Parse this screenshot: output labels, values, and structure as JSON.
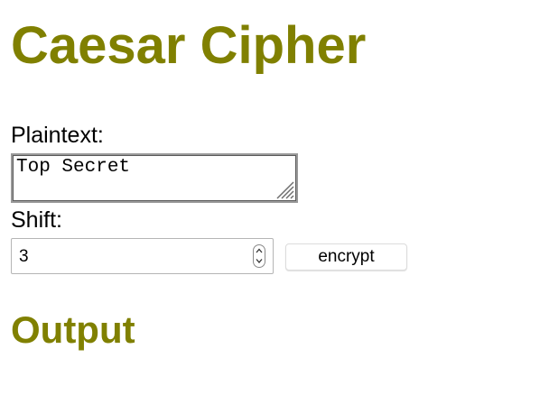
{
  "page": {
    "title": "Caesar Cipher",
    "accent_color": "#808000"
  },
  "form": {
    "plaintext_label": "Plaintext:",
    "plaintext_value": "Top Secret",
    "shift_label": "Shift:",
    "shift_value": "3",
    "encrypt_label": "encrypt"
  },
  "output": {
    "heading": "Output",
    "text": ""
  },
  "icons": {
    "resize_grip": "resize-grip-icon",
    "stepper_up": "chevron-up-icon",
    "stepper_down": "chevron-down-icon"
  }
}
